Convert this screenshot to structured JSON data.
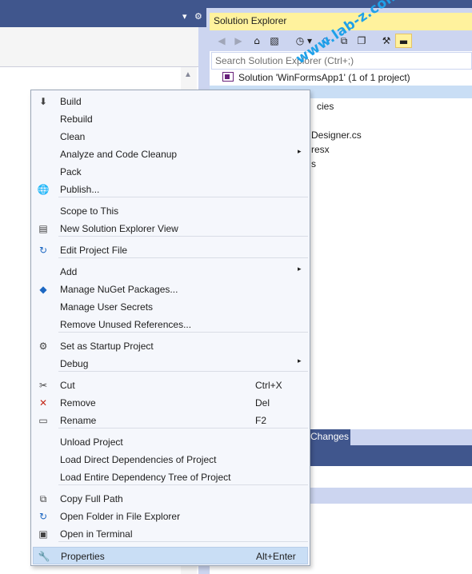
{
  "colors": {
    "title_bar": "#40568d",
    "background": "#ccd5f0",
    "active_title": "#fff29d",
    "menu_background": "#f5f7fc",
    "highlight": "#c9def5",
    "watermark": "#1ea1e9"
  },
  "left_panel": {
    "pin_icon": "▾",
    "gear_icon": "⚙",
    "scroll_up_icon": "▲"
  },
  "solution_explorer": {
    "title": "Solution Explorer",
    "toolbar_icons": [
      "back-icon",
      "forward-icon",
      "home-icon",
      "switch-views-icon",
      "history-icon",
      "sync-icon",
      "collapse-all-icon",
      "show-all-files-icon",
      "properties-icon",
      "preview-icon"
    ],
    "search_placeholder": "Search Solution Explorer (Ctrl+;)",
    "tree": {
      "solution_label": "Solution 'WinFormsApp1' (1 of 1 project)",
      "partial_items": [
        "cies",
        "Designer.cs",
        "resx",
        "s"
      ]
    },
    "bottom_tab": "Changes"
  },
  "watermark": "www.lab-z.com",
  "context_menu": {
    "items": [
      {
        "label": "Build",
        "icon": "build-icon",
        "glyph": "⬇",
        "color": "#424242"
      },
      {
        "label": "Rebuild"
      },
      {
        "label": "Clean"
      },
      {
        "label": "Analyze and Code Cleanup",
        "submenu": "▸"
      },
      {
        "label": "Pack"
      },
      {
        "label": "Publish...",
        "icon": "globe-icon",
        "glyph": "🌐",
        "color": "#1c97ea"
      },
      {
        "label": "Scope to This"
      },
      {
        "label": "New Solution Explorer View",
        "icon": "new-view-icon",
        "glyph": "▤",
        "color": "#424242"
      },
      {
        "label": "Edit Project File",
        "icon": "edit-arrow-icon",
        "glyph": "↻",
        "color": "#1c67c2"
      },
      {
        "label": "Add",
        "submenu": "▸"
      },
      {
        "label": "Manage NuGet Packages...",
        "icon": "nuget-icon",
        "glyph": "◆",
        "color": "#1c67c2"
      },
      {
        "label": "Manage User Secrets"
      },
      {
        "label": "Remove Unused References..."
      },
      {
        "label": "Set as Startup Project",
        "icon": "gear-icon",
        "glyph": "⚙",
        "color": "#424242"
      },
      {
        "label": "Debug",
        "submenu": "▸"
      },
      {
        "label": "Cut",
        "shortcut": "Ctrl+X",
        "icon": "scissors-icon",
        "glyph": "✂",
        "color": "#424242"
      },
      {
        "label": "Remove",
        "shortcut": "Del",
        "icon": "remove-x-icon",
        "glyph": "✕",
        "color": "#c42b1c"
      },
      {
        "label": "Rename",
        "shortcut": "F2",
        "icon": "rename-icon",
        "glyph": "▭",
        "color": "#424242"
      },
      {
        "label": "Unload Project"
      },
      {
        "label": "Load Direct Dependencies of Project"
      },
      {
        "label": "Load Entire Dependency Tree of Project"
      },
      {
        "label": "Copy Full Path",
        "icon": "copy-icon",
        "glyph": "⧉",
        "color": "#424242"
      },
      {
        "label": "Open Folder in File Explorer",
        "icon": "open-folder-icon",
        "glyph": "↻",
        "color": "#1c67c2"
      },
      {
        "label": "Open in Terminal",
        "icon": "terminal-icon",
        "glyph": "▣",
        "color": "#424242"
      },
      {
        "label": "Properties",
        "shortcut": "Alt+Enter",
        "icon": "wrench-icon",
        "glyph": "🔧",
        "color": "#424242",
        "highlighted": true
      }
    ]
  }
}
